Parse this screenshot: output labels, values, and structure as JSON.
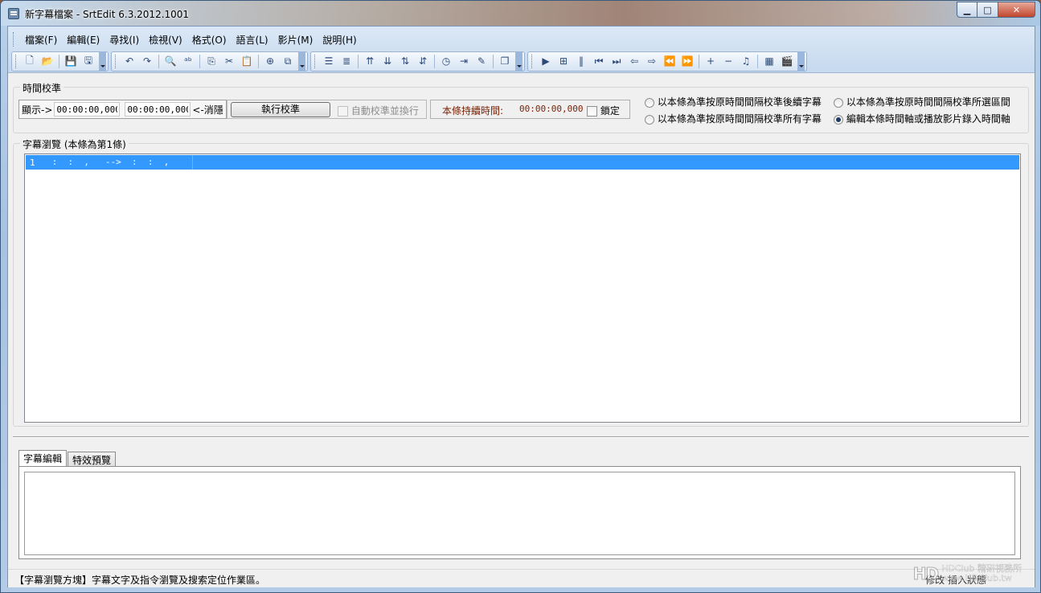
{
  "window": {
    "title": "新字幕檔案 - SrtEdit 6.3.2012.1001",
    "min_glyph": "▁",
    "max_glyph": "□",
    "close_glyph": "✕"
  },
  "menu": [
    {
      "label": "檔案(F)"
    },
    {
      "label": "編輯(E)"
    },
    {
      "label": "尋找(I)"
    },
    {
      "label": "檢視(V)"
    },
    {
      "label": "格式(O)"
    },
    {
      "label": "語言(L)"
    },
    {
      "label": "影片(M)"
    },
    {
      "label": "說明(H)"
    }
  ],
  "toolbar": {
    "new_glyph": "🗋",
    "open_glyph": "📂",
    "save_glyph": "💾",
    "saveas_glyph": "🖫",
    "undo_glyph": "↶",
    "redo_glyph": "↷",
    "find_glyph": "🔍",
    "replace_glyph": "ᵃᵇ",
    "copy_glyph": "⎘",
    "cut_glyph": "✂",
    "paste_glyph": "📋",
    "insert_glyph": "⊕",
    "paste2_glyph": "⧉",
    "align1_glyph": "☰",
    "align2_glyph": "≣",
    "ins_before_glyph": "⇈",
    "ins_after_glyph": "⇊",
    "move_up_glyph": "⇅",
    "move_down_glyph": "⇵",
    "clock_glyph": "◷",
    "goto_glyph": "⇥",
    "tool_glyph": "✎",
    "window_glyph": "❐",
    "play_glyph": "▶",
    "frame_glyph": "⊞",
    "pause_glyph": "‖",
    "first_glyph": "⏮",
    "last_glyph": "⏭",
    "back_glyph": "⇦",
    "fwd_glyph": "⇨",
    "rew_glyph": "⏪",
    "ff_glyph": "⏩",
    "plus_glyph": "+",
    "minus_glyph": "−",
    "music_glyph": "♫",
    "film_glyph": "▦",
    "clap_glyph": "🎬"
  },
  "calibration": {
    "group_title": "時間校準",
    "display_label": "顯示->",
    "time_start": "00:00:00,000",
    "time_end": "00:00:00,000",
    "cancel_label": "<-消隱",
    "exec_button": "執行校準",
    "auto_label": "自動校準並換行",
    "duration_label": "本條持續時間:",
    "duration_value": "00:00:00,000",
    "lock_label": "鎖定",
    "radio1": "以本條為準按原時間間隔校準後續字幕",
    "radio2": "以本條為準按原時間間隔校準所有字幕",
    "radio3": "以本條為準按原時間間隔校準所選區間",
    "radio4": "編輯本條時間軸或播放影片錄入時間軸"
  },
  "browse": {
    "group_title": "字幕瀏覽 (本條為第1條)",
    "rows": [
      {
        "no": "1",
        "timecode": " :  :  ,   -->  :  :  ,"
      }
    ]
  },
  "tabs": [
    {
      "label": "字幕編輯"
    },
    {
      "label": "特效預覽"
    }
  ],
  "status": {
    "text": "【字幕瀏覽方塊】字幕文字及指令瀏覽及搜索定位作業區。",
    "right": "修改   插入狀態"
  },
  "watermark": {
    "logo": "HD",
    "line1": "HDClub 精研視務所",
    "line2": "www.HDClub.tw"
  }
}
